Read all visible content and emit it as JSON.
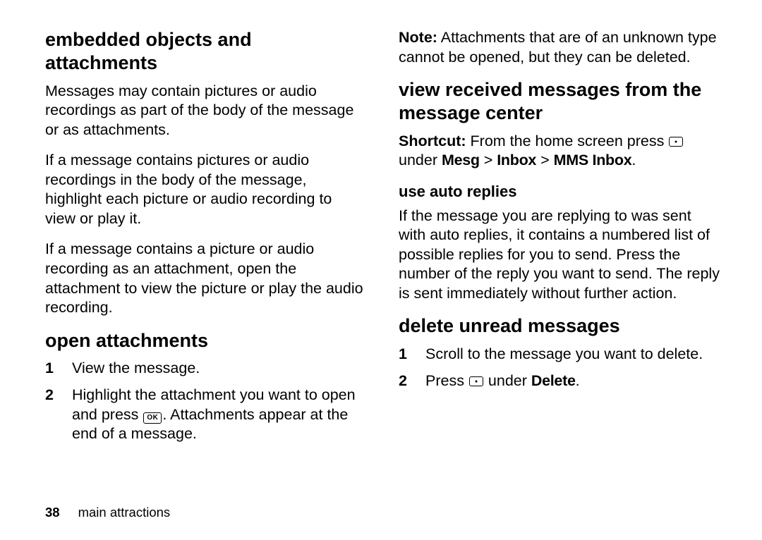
{
  "left": {
    "h_embedded": "embedded objects and attachments",
    "p1": "Messages may contain pictures or audio recordings as part of the body of the message or as attachments.",
    "p2": "If a message contains pictures or audio recordings in the body of the message, highlight each picture or audio recording to view or play it.",
    "p3": "If a message contains a picture or audio recording as an attachment, open the attachment to view the picture or play the audio recording.",
    "h_open": "open attachments",
    "step1": "View the message.",
    "step2a": "Highlight the attachment you want to open and press ",
    "step2b": ". Attachments appear at the end of a message."
  },
  "right": {
    "note_label": "Note:",
    "note_body": " Attachments that are of an unknown type cannot be opened, but they can be deleted.",
    "h_view": "view received messages from the message center",
    "shortcut_label": "Shortcut:",
    "shortcut_a": " From the home screen press ",
    "shortcut_under": " under ",
    "path_mesg": "Mesg",
    "path_inbox": "Inbox",
    "path_mms": "MMS Inbox",
    "gt": " > ",
    "h_auto": "use auto replies",
    "auto_body": "If the message you are replying to was sent with auto replies, it contains a numbered list of possible replies for you to send. Press the number of the reply you want to send. The reply is sent immediately without further action.",
    "h_delete": "delete unread messages",
    "d1": "Scroll to the message you want to delete.",
    "d2a": "Press ",
    "d2b": " under ",
    "d2c": "Delete",
    "d2d": "."
  },
  "footer": {
    "page": "38",
    "section": "main attractions"
  },
  "nums": {
    "n1": "1",
    "n2": "2"
  },
  "ok_label": "OK"
}
